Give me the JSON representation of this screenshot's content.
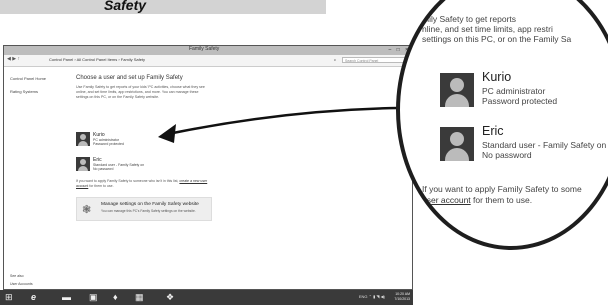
{
  "banner": {
    "text": "Safety"
  },
  "window": {
    "title": "Family Safety",
    "controls": "– □ ×",
    "nav": "◀ ▶ ↑",
    "breadcrumb": "Control Panel › All Control Panel Items › Family Safety",
    "refresh": "c",
    "search_placeholder": "Search Control Panel"
  },
  "leftnav": {
    "items": [
      "Control Panel Home",
      "Rating Systems"
    ],
    "see_also": "See also",
    "user_accounts": "User Accounts"
  },
  "main": {
    "heading": "Choose a user and set up Family Safety",
    "intro": "Use Family Safety to get reports of your kids' PC activities, choose what they see online, and set time limits, app restrictions, and more. You can manage these settings on this PC, or on the Family Safety website.",
    "accounts": [
      {
        "name": "Kurio",
        "line1": "PC administrator",
        "line2": "Password protected"
      },
      {
        "name": "Eric",
        "line1": "Standard user - Family Safety on",
        "line2": "No password"
      }
    ],
    "note_prefix": "If you want to apply Family Safety to someone who isn't in this list, ",
    "note_link": "create a new user account",
    "note_suffix": " for them to use.",
    "manage_title": "Manage settings on the Family Safety website",
    "manage_desc": "You can manage this PC's Family Safety settings on the website."
  },
  "taskbar": {
    "tray": "ENG",
    "time": "10:20 AM",
    "date": "7/10/2013"
  },
  "bubble": {
    "intro_lines": [
      "mily Safety to get reports",
      "nline, and set time limits, app restri",
      "settings on this PC, or on the Family Sa"
    ],
    "accounts": [
      {
        "name": "Kurio",
        "line1": "PC administrator",
        "line2": "Password protected"
      },
      {
        "name": "Eric",
        "line1": "Standard user - Family Safety on",
        "line2": "No password"
      }
    ],
    "note_prefix": "If you want to apply Family Safety to some",
    "note_link": "user account",
    "note_suffix": " for them to use."
  }
}
